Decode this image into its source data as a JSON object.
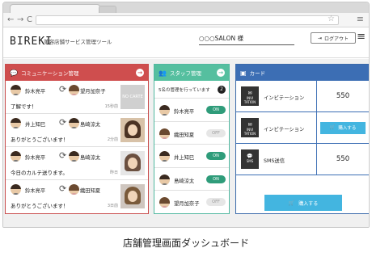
{
  "app": {
    "logo": "BIREKI",
    "subtitle": "美容店舗サービス管理ツール",
    "salon": "○○○SALON 様",
    "logout_label": "ログアウト"
  },
  "browser": {
    "back": "←",
    "forward": "→",
    "reload": "C",
    "star": "☆",
    "menu": "≡"
  },
  "communication": {
    "title": "コミュニケーション管理",
    "rows": [
      {
        "from": "鈴木亮平",
        "to": "望月加奈子",
        "message": "了解です！",
        "time": "15秒前",
        "photo": "NO CARTE"
      },
      {
        "from": "井上知巳",
        "to": "島崎涼太",
        "message": "ありがとうございます！",
        "time": "2分前",
        "photo": ""
      },
      {
        "from": "鈴木亮平",
        "to": "島崎涼太",
        "message": "今日のカルテ送ります。",
        "time": "昨日",
        "photo": ""
      },
      {
        "from": "鈴木亮平",
        "to": "織田知夏",
        "message": "ありがとうございます！",
        "time": "3日前",
        "photo": ""
      }
    ]
  },
  "staff": {
    "title": "スタッフ管理",
    "note": "5名の管理を行っています",
    "count": "2",
    "members": [
      {
        "name": "鈴木亮平",
        "status": "ON"
      },
      {
        "name": "織田知夏",
        "status": "OFF"
      },
      {
        "name": "井上知巳",
        "status": "ON"
      },
      {
        "name": "島崎涼太",
        "status": "ON"
      },
      {
        "name": "望月加奈子",
        "status": "OFF"
      }
    ]
  },
  "card": {
    "title": "カード",
    "rows": [
      {
        "icon_text": "INVI TATION",
        "label": "インビテーション",
        "value": "550"
      },
      {
        "icon_text": "INVI TATION",
        "label": "インビテーション",
        "value": "購入する"
      },
      {
        "icon_text": "SMS",
        "label": "SMS送信",
        "value": "550"
      }
    ],
    "buy_label": "購入する"
  },
  "caption": "店舗管理画面ダッシュボード",
  "colors": {
    "communication": "#cf4e4e",
    "staff": "#55bf9f",
    "card": "#3c6eb4",
    "buy": "#43b5e0"
  }
}
